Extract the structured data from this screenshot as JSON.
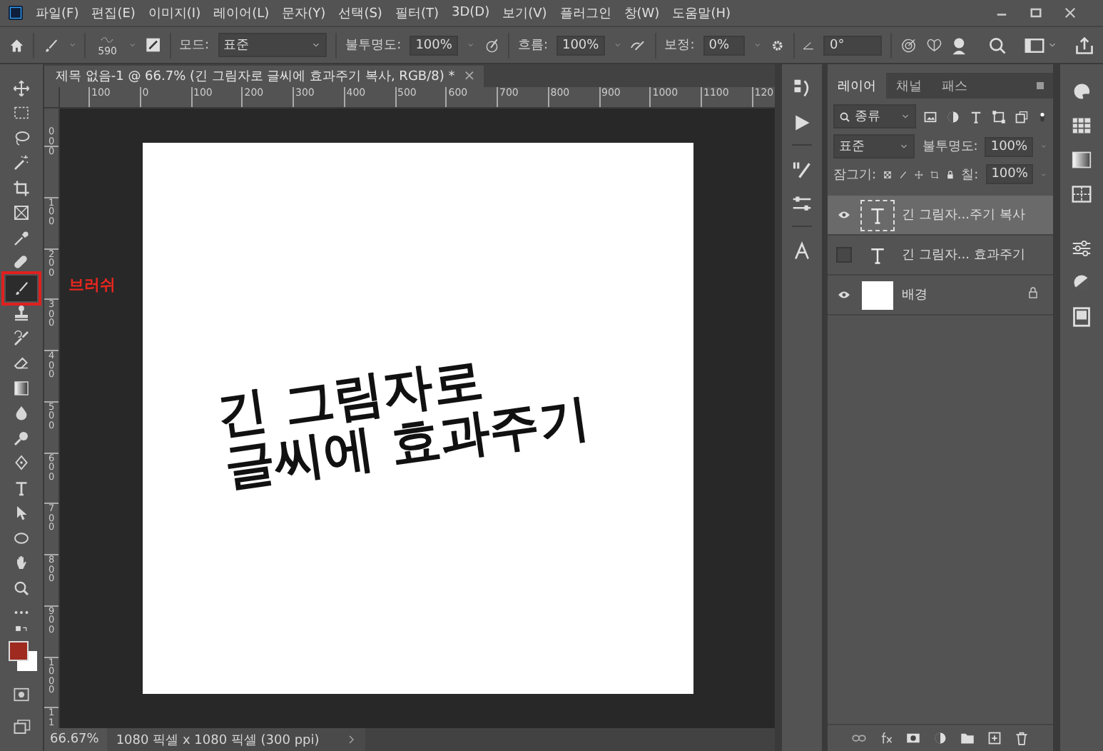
{
  "menu": [
    "파일(F)",
    "편집(E)",
    "이미지(I)",
    "레이어(L)",
    "문자(Y)",
    "선택(S)",
    "필터(T)",
    "3D(D)",
    "보기(V)",
    "플러그인",
    "창(W)",
    "도움말(H)"
  ],
  "options_bar": {
    "brush_size": "590",
    "mode_label": "모드:",
    "mode": "표준",
    "opacity_label": "불투명도:",
    "opacity": "100%",
    "flow_label": "흐름:",
    "flow": "100%",
    "smoothing_label": "보정:",
    "smoothing": "0%",
    "angle": "0°"
  },
  "document_tab": {
    "title": "제목 없음-1 @ 66.7% (긴 그림자로 글씨에 효과주기 복사, RGB/8) *",
    "close": "×"
  },
  "ruler_h": [
    "100",
    "0",
    "100",
    "200",
    "300",
    "400",
    "500",
    "600",
    "700",
    "800",
    "900",
    "1000",
    "1100",
    "120"
  ],
  "ruler_v": [
    "00",
    "0",
    "100",
    "200",
    "300",
    "400",
    "500",
    "600",
    "700",
    "800",
    "900",
    "1000",
    "11"
  ],
  "tools": [
    {
      "selected": false
    },
    {
      "selected": false
    },
    {
      "selected": false
    },
    {
      "selected": false
    },
    {
      "selected": false
    },
    {
      "selected": false
    },
    {
      "selected": false
    },
    {
      "selected": false
    },
    {
      "selected": true
    },
    {
      "selected": false
    },
    {
      "selected": false
    },
    {
      "selected": false
    },
    {
      "selected": false
    },
    {
      "selected": false
    },
    {
      "selected": false
    },
    {
      "selected": false
    },
    {
      "selected": false
    },
    {
      "selected": false
    },
    {
      "selected": false
    },
    {
      "selected": false
    },
    {
      "selected": false
    },
    {
      "selected": false
    }
  ],
  "annotation": {
    "text": "브러쉬"
  },
  "swatches": [
    {
      "color": "#9e2a20"
    },
    {
      "color": "#ffffff"
    }
  ],
  "canvas_text": [
    "긴 그림자로",
    "글씨에 효과주기"
  ],
  "layers_panel": {
    "tabs": [
      {
        "label": "레이어",
        "selected": true
      },
      {
        "label": "채널",
        "selected": false
      },
      {
        "label": "패스",
        "selected": false
      }
    ],
    "filter": "종류",
    "blend_mode": "표준",
    "opacity_label": "불투명도:",
    "opacity": "100%",
    "lock_label": "잠그기:",
    "fill_label": "칠:",
    "fill": "100%",
    "layers": [
      {
        "name": "긴 그림자...주기 복사",
        "kind": "text",
        "visible": true,
        "selected": true,
        "locked": false
      },
      {
        "name": "긴 그림자... 효과주기",
        "kind": "text",
        "visible": false,
        "selected": false,
        "locked": false
      },
      {
        "name": "배경",
        "kind": "image",
        "visible": true,
        "selected": false,
        "locked": true
      }
    ]
  },
  "status_bar": {
    "zoom": "66.67%",
    "info": "1080 픽셀 x 1080 픽셀 (300 ppi)"
  }
}
